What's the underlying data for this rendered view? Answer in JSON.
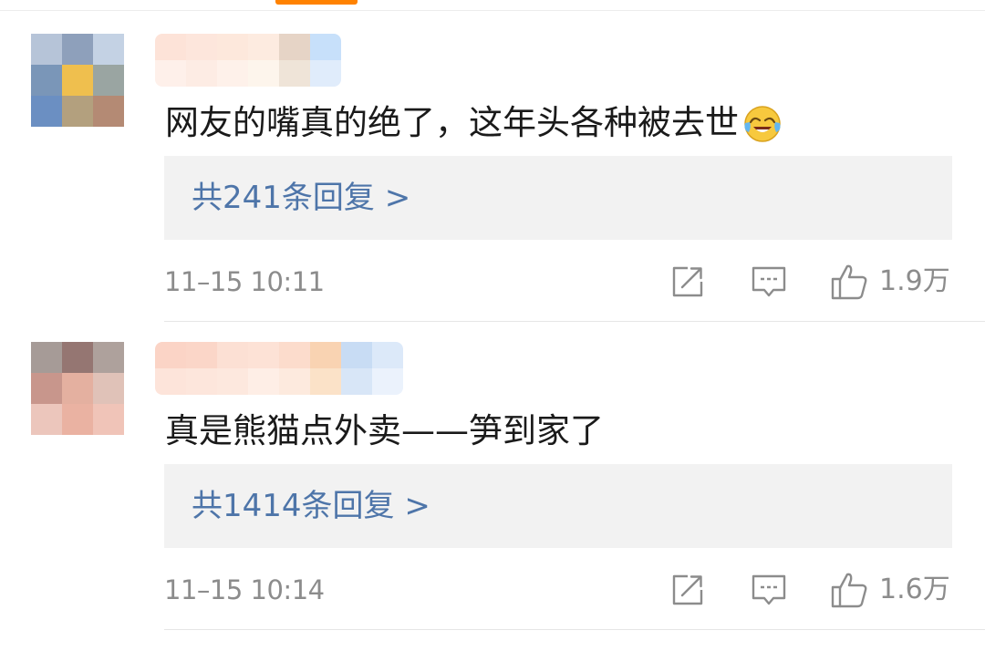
{
  "colors": {
    "accent_tab": "#ff8200",
    "link": "#4e75a9",
    "reply_box_bg": "#f2f2f2",
    "meta_text": "#8c8c8c",
    "body_text": "#1a1a1a"
  },
  "comments": [
    {
      "text": "网友的嘴真的绝了，这年头各种被去世",
      "emoji": "laughing-crying-emoji-icon",
      "reply_summary": "共241条回复 >",
      "timestamp": "11–15 10:11",
      "likes": "1.9万",
      "avatar_pixels": [
        "#b6c4d8",
        "#8ea0bb",
        "#c4d2e4",
        "#7a96b8",
        "#efbf4e",
        "#9aa5a2",
        "#6b8fc2",
        "#b3a07e",
        "#b48a74"
      ],
      "name_pixels": [
        "#fde3d8",
        "#fef0ea",
        "#fde6dc",
        "#fdece4",
        "#fde8dc",
        "#fef1ea",
        "#fdebe0",
        "#fdf5ec",
        "#e6d4c6",
        "#efe4d8",
        "#c7e0fa",
        "#e0ecfb"
      ]
    },
    {
      "text": "真是熊猫点外卖——笋到家了",
      "emoji": "",
      "reply_summary": "共1414条回复 >",
      "timestamp": "11–15 10:14",
      "likes": "1.6万",
      "avatar_pixels": [
        "#a69b97",
        "#957672",
        "#aea19c",
        "#c8968c",
        "#e4b0a0",
        "#e0c2b8",
        "#ecc6bc",
        "#eab2a2",
        "#f0c4b8"
      ],
      "name_pixels": [
        "#fbd4c6",
        "#fde4da",
        "#fbd6c8",
        "#fde6dc",
        "#fce0d4",
        "#fde8de",
        "#fde2d6",
        "#feeee6",
        "#fcdccc",
        "#fdeade",
        "#f9d3b2",
        "#fbe2c8",
        "#c8dcf4",
        "#d8e6f7",
        "#dce9f9",
        "#ebf2fc"
      ]
    }
  ]
}
